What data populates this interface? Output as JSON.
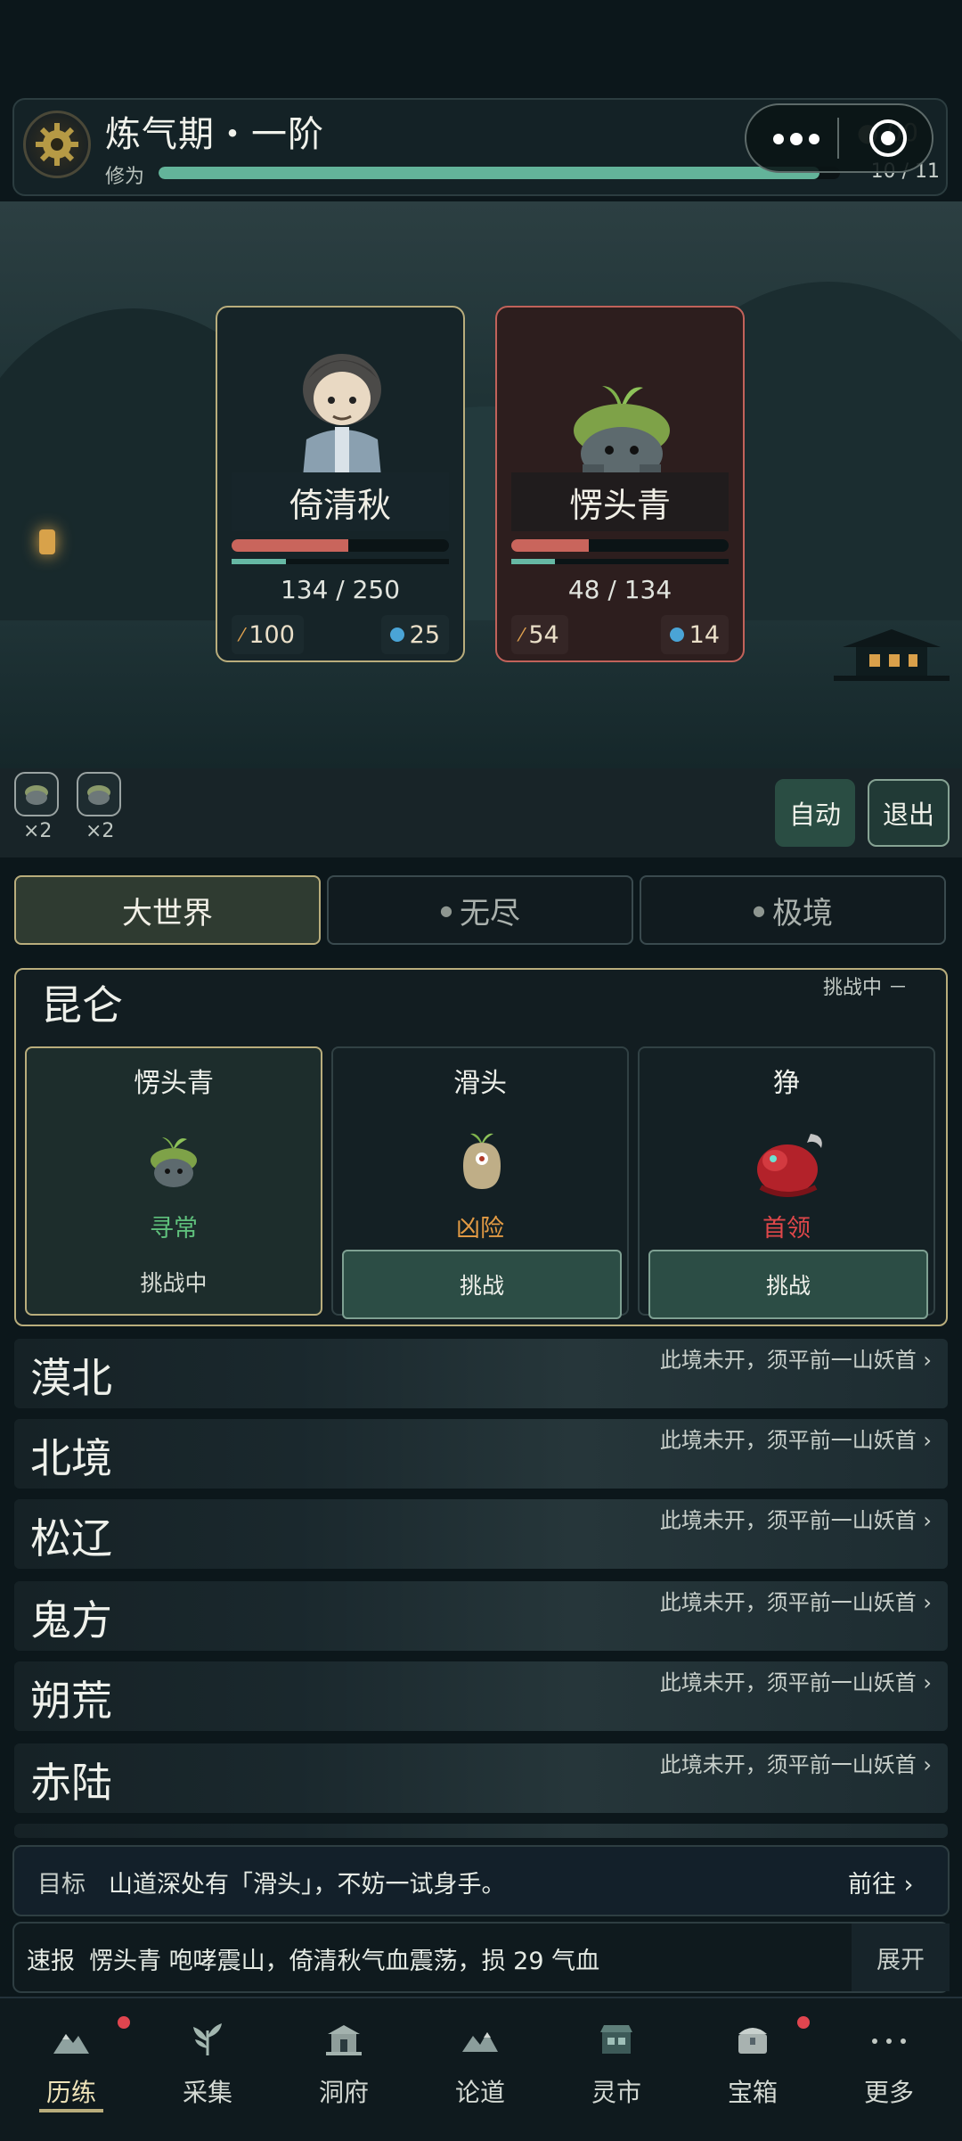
{
  "header": {
    "realm_title": "炼气期・一阶",
    "cultivation_label": "修为",
    "xp_fraction": 0.97,
    "xp_count": "10 / 11",
    "coin_partial": "00"
  },
  "battle": {
    "player": {
      "name": "倚清秋",
      "hp_text": "134 / 250",
      "hp_fraction": 0.536,
      "mp_fraction": 0.25,
      "attack": "100",
      "defense": "25"
    },
    "enemy": {
      "name": "愣头青",
      "hp_text": "48 / 134",
      "hp_fraction": 0.358,
      "mp_fraction": 0.2,
      "attack": "54",
      "defense": "14"
    },
    "items": [
      {
        "count": "×2"
      },
      {
        "count": "×2"
      }
    ],
    "auto_label": "自动",
    "exit_label": "退出"
  },
  "tabs": [
    {
      "label": "大世界",
      "locked": false,
      "active": true
    },
    {
      "label": "无尽",
      "locked": true,
      "active": false
    },
    {
      "label": "极境",
      "locked": true,
      "active": false
    }
  ],
  "region": {
    "name": "昆仑",
    "status": "挑战中 －",
    "monsters": [
      {
        "name": "愣头青",
        "rank": "寻常",
        "rank_color": "#5fc07c",
        "action": "挑战中"
      },
      {
        "name": "滑头",
        "rank": "凶险",
        "rank_color": "#e29a44",
        "action": "挑战"
      },
      {
        "name": "狰",
        "rank": "首领",
        "rank_color": "#e0474a",
        "action": "挑战"
      }
    ]
  },
  "locked_regions": [
    {
      "name": "漠北",
      "note": "此境未开，须平前一山妖首"
    },
    {
      "name": "北境",
      "note": "此境未开，须平前一山妖首"
    },
    {
      "name": "松辽",
      "note": "此境未开，须平前一山妖首"
    },
    {
      "name": "鬼方",
      "note": "此境未开，须平前一山妖首"
    },
    {
      "name": "朔荒",
      "note": "此境未开，须平前一山妖首"
    },
    {
      "name": "赤陆",
      "note": "此境未开，须平前一山妖首"
    }
  ],
  "goal": {
    "label": "目标",
    "text": "山道深处有「滑头」，不妨一试身手。",
    "go_label": "前往"
  },
  "report": {
    "label": "速报",
    "text": "愣头青 咆哮震山，倚清秋气血震荡，损 29 气血",
    "expand_label": "展开"
  },
  "nav": [
    {
      "label": "历练",
      "icon": "mountain-icon",
      "active": true,
      "badge": true
    },
    {
      "label": "采集",
      "icon": "herb-icon",
      "active": false,
      "badge": false
    },
    {
      "label": "洞府",
      "icon": "pavilion-icon",
      "active": false,
      "badge": false
    },
    {
      "label": "论道",
      "icon": "peaks-icon",
      "active": false,
      "badge": false
    },
    {
      "label": "灵市",
      "icon": "market-icon",
      "active": false,
      "badge": false
    },
    {
      "label": "宝箱",
      "icon": "chest-icon",
      "active": false,
      "badge": true
    },
    {
      "label": "更多",
      "icon": "more-icon",
      "active": false,
      "badge": false
    }
  ]
}
